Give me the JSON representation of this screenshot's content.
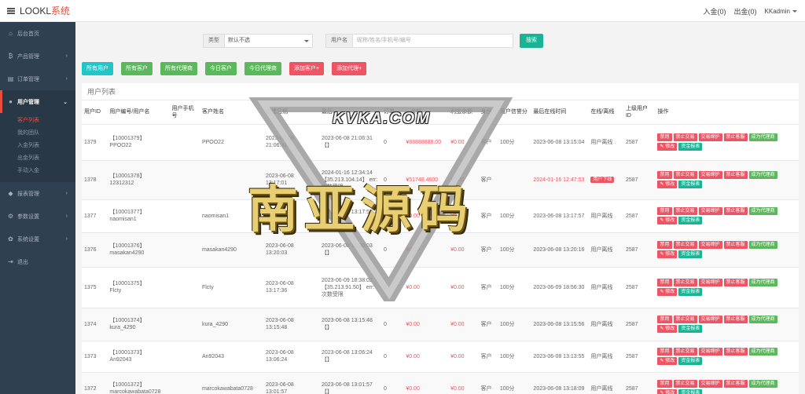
{
  "brand": {
    "name": "LOOKL",
    "suffix": "系统"
  },
  "topbar": {
    "deposit": "入金(0)",
    "withdraw": "出金(0)",
    "admin": "KKadmin"
  },
  "sidebar": {
    "items": [
      {
        "label": "后台首页",
        "icon": "home-icon"
      },
      {
        "label": "产品管理",
        "icon": "bitcoin-icon"
      },
      {
        "label": "订单管理",
        "icon": "orders-icon"
      },
      {
        "label": "用户管理",
        "icon": "user-icon"
      },
      {
        "label": "报表管理",
        "icon": "report-icon"
      },
      {
        "label": "参数设置",
        "icon": "gear-icon"
      },
      {
        "label": "系统设置",
        "icon": "settings-icon"
      },
      {
        "label": "退出",
        "icon": "logout-icon"
      }
    ],
    "sub": [
      "客户列表",
      "我的团队",
      "入金列表",
      "出金列表",
      "手动入金"
    ]
  },
  "filter": {
    "type_label": "类型",
    "type_value": "默认不选",
    "user_label": "用户名",
    "user_placeholder": "昵称/姓名/手机号/编号",
    "search": "搜索"
  },
  "tabs": [
    "所有用户",
    "所有客户",
    "所有代理商",
    "今日客户",
    "今日代理商",
    "添加客户+",
    "添加代理+"
  ],
  "panel": {
    "title": "用户列表"
  },
  "columns": [
    "用户ID",
    "用户编号/用户名",
    "用户手机号",
    "客户姓名",
    "创建日期",
    "最后...",
    "订单",
    "...余额",
    "利宝余额",
    "身份",
    "用户信誉分",
    "最后在线时间",
    "在线/离线",
    "上级用户ID",
    "操作"
  ],
  "ops": [
    "禁用",
    "禁止交易",
    "交易缔护",
    "禁止客服",
    "成为代理商",
    "修改",
    "资金报表"
  ],
  "rows": [
    {
      "id": "1379",
      "code": "【10001379】",
      "name": "PPOO22",
      "phone": "",
      "realname": "PPOO22",
      "created": "2023-06-08 21:06:31",
      "last": "2023-06-08 21:06:31 【】",
      "orders": "0",
      "balance": "¥88888888.00",
      "lb": "¥0.00",
      "role": "客户",
      "score": "100分",
      "online_time": "2023-06-08 13:15:04",
      "status": "用户离线",
      "parent": "2587"
    },
    {
      "id": "1378",
      "code": "【10001378】",
      "name": "12312312",
      "phone": "",
      "realname": "",
      "created": "2023-06-08 13:17:01",
      "last": "2024-01-16 12:34:14 【35.213.104.14】 err:次数受限",
      "orders": "0",
      "balance": "¥51748.4600",
      "lb": "¥0.00",
      "role": "客户",
      "score": "",
      "online_time": "2024-01-16 12:47:53",
      "status": "用户下线",
      "parent": "2587"
    },
    {
      "id": "1377",
      "code": "【10001377】",
      "name": "naomisan1",
      "phone": "",
      "realname": "naomisan1",
      "created": "2023-06-08 13:17:57",
      "last": "2023-06-08 13:17:57 【】",
      "orders": "0",
      "balance": "¥0.00",
      "lb": "¥0.00",
      "role": "客户",
      "score": "100分",
      "online_time": "2023-06-08 13:17:57",
      "status": "用户离线",
      "parent": "2587"
    },
    {
      "id": "1376",
      "code": "【10001376】",
      "name": "masakan4290",
      "phone": "",
      "realname": "masakan4290",
      "created": "2023-06-08 13:20:03",
      "last": "2023-06-08 13:20:03 【】",
      "orders": "0",
      "balance": "¥0.00",
      "lb": "¥0.00",
      "role": "客户",
      "score": "100分",
      "online_time": "2023-06-08 13:20:16",
      "status": "用户离线",
      "parent": "2587"
    },
    {
      "id": "1375",
      "code": "【10001375】",
      "name": "Flcty",
      "phone": "",
      "realname": "Flcty",
      "created": "2023-06-08 13:17:36",
      "last": "2023-06-09 18:38:02 【35.213.91.50】 err:次数受限",
      "orders": "0",
      "balance": "¥0.00",
      "lb": "¥0.00",
      "role": "客户",
      "score": "100分",
      "online_time": "2023-06-09 18:56:30",
      "status": "用户离线",
      "parent": "2587"
    },
    {
      "id": "1374",
      "code": "【10001374】",
      "name": "kura_4290",
      "phone": "",
      "realname": "kura_4290",
      "created": "2023-06-08 13:15:48",
      "last": "2023-06-08 13:15:48 【】",
      "orders": "0",
      "balance": "¥0.00",
      "lb": "¥0.00",
      "role": "客户",
      "score": "100分",
      "online_time": "2023-06-08 13:15:56",
      "status": "用户离线",
      "parent": "2587"
    },
    {
      "id": "1373",
      "code": "【10001373】",
      "name": "An92043",
      "phone": "",
      "realname": "An92043",
      "created": "2023-06-08 13:06:24",
      "last": "2023-06-08 13:06:24 【】",
      "orders": "0",
      "balance": "¥0.00",
      "lb": "¥0.00",
      "role": "客户",
      "score": "100分",
      "online_time": "2023-06-08 13:13:55",
      "status": "用户离线",
      "parent": "2587"
    },
    {
      "id": "1372",
      "code": "【10001372】",
      "name": "marcokawabata0728",
      "phone": "",
      "realname": "marcokawabata0728",
      "created": "2023-06-08 13:01:57",
      "last": "2023-06-08 13:01:57 【】",
      "orders": "0",
      "balance": "¥0.00",
      "lb": "¥0.00",
      "role": "客户",
      "score": "100分",
      "online_time": "2023-06-08 13:18:09",
      "status": "用户离线",
      "parent": "2587"
    }
  ],
  "watermark": {
    "site": "KVKA.COM",
    "main": "南亚源码"
  },
  "colors": {
    "sidebar": "#2f4050",
    "primary": "#1ab394",
    "danger": "#ed5565",
    "info": "#23c6c8",
    "success": "#5cb85c"
  }
}
